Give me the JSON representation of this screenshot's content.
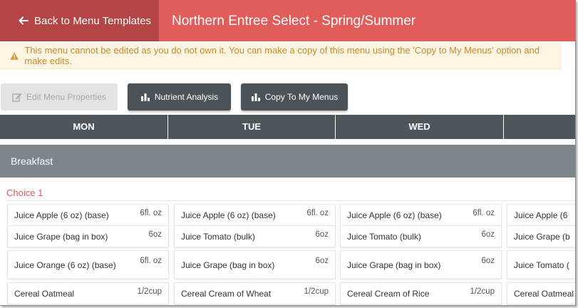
{
  "header": {
    "back_label": "Back to Menu Templates",
    "title": "Northern Entree Select - Spring/Summer",
    "accent_color": "#e05d5b",
    "back_color": "#b54446"
  },
  "warning": {
    "text": "This menu cannot be edited as you do not own it. You can make a copy of this menu using the 'Copy to My Menus' option and make edits.",
    "icon": "warning-triangle-icon"
  },
  "toolbar": {
    "edit_label": "Edit Menu Properties",
    "nutrient_label": "Nutrient Analysis",
    "copy_label": "Copy To My Menus"
  },
  "days": [
    "MON",
    "TUE",
    "WED",
    ""
  ],
  "meal": {
    "name": "Breakfast",
    "choice": "Choice 1",
    "columns": [
      {
        "items": [
          {
            "name": "Juice Apple (6 oz) (base)",
            "qty": "6fl. oz"
          },
          {
            "name": "Juice Grape (bag in box)",
            "qty": "6oz"
          },
          {
            "name": "Juice Orange (6 oz) (base)",
            "qty": "6fl. oz"
          },
          {
            "name": "Cereal Oatmeal",
            "qty": "1/2cup"
          }
        ]
      },
      {
        "items": [
          {
            "name": "Juice Apple (6 oz) (base)",
            "qty": "6fl. oz"
          },
          {
            "name": "Juice Tomato (bulk)",
            "qty": "6oz"
          },
          {
            "name": "Juice Grape (bag in box)",
            "qty": "6oz"
          },
          {
            "name": "Cereal Cream of Wheat",
            "qty": "1/2cup"
          }
        ]
      },
      {
        "items": [
          {
            "name": "Juice Apple (6 oz) (base)",
            "qty": "6fl. oz"
          },
          {
            "name": "Juice Tomato (bulk)",
            "qty": "6oz"
          },
          {
            "name": "Juice Grape (bag in box)",
            "qty": "6oz"
          },
          {
            "name": "Cereal Cream of Rice",
            "qty": "1/2cup"
          }
        ]
      },
      {
        "items": [
          {
            "name": "Juice Apple (6",
            "qty": ""
          },
          {
            "name": "Juice Grape (b",
            "qty": ""
          },
          {
            "name": "Juice Tomato (",
            "qty": ""
          },
          {
            "name": "Cereal Oatmeal",
            "qty": ""
          }
        ]
      }
    ]
  }
}
